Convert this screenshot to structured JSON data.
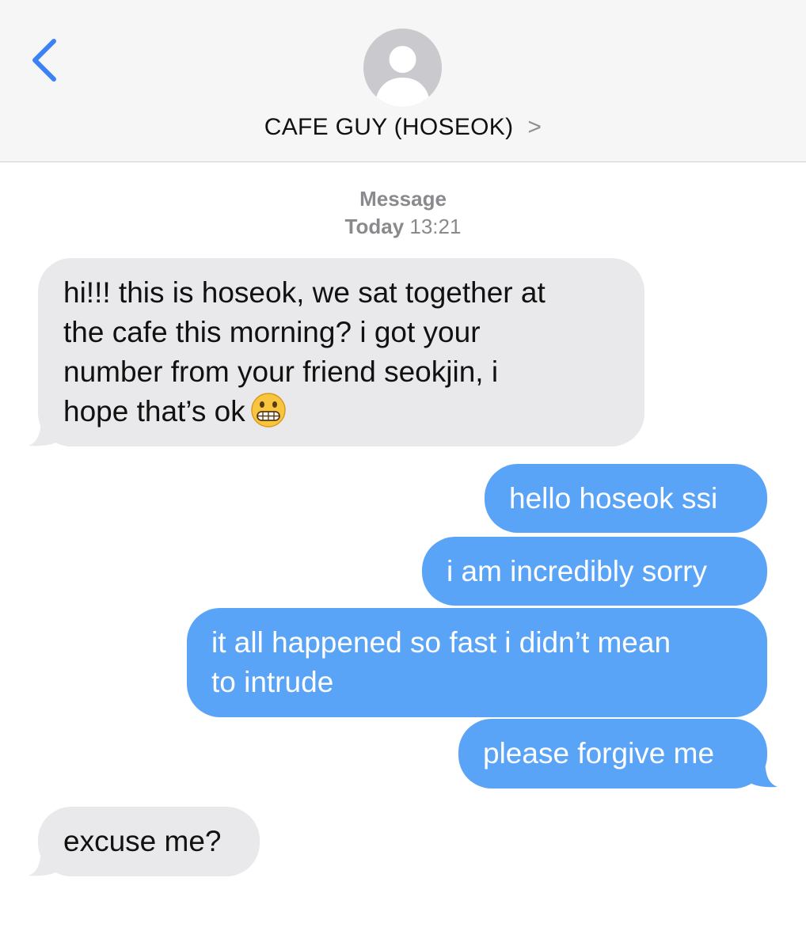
{
  "header": {
    "contact_name": "CAFE GUY (HOSEOK)",
    "chevron": ">",
    "back_icon": "chevron-left-icon",
    "accent": "#3b82f6"
  },
  "thread": {
    "service": "Message",
    "day": "Today",
    "time": "13:21"
  },
  "messages": [
    {
      "from": "them",
      "text": "hi!!! this is hoseok, we sat together at\nthe cafe this morning? i got your\nnumber from your friend seokjin, i\nhope that’s ok",
      "emoji": "grimacing-face"
    },
    {
      "from": "me",
      "text": "hello hoseok ssi"
    },
    {
      "from": "me",
      "text": "i am incredibly sorry"
    },
    {
      "from": "me",
      "text": "it all happened so fast i didn’t mean\nto intrude"
    },
    {
      "from": "me",
      "text": "please forgive me"
    },
    {
      "from": "them",
      "text": "excuse me?"
    }
  ],
  "colors": {
    "sent_bubble": "#5aa4f7",
    "received_bubble": "#e9e9eb",
    "header_bg": "#f6f6f6"
  }
}
